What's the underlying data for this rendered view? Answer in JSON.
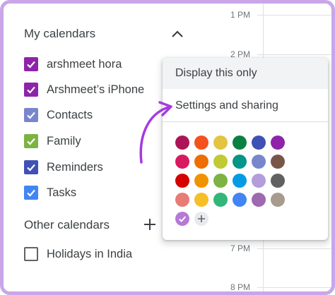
{
  "timeline": {
    "times": [
      "1 PM",
      "2 PM",
      "7 PM",
      "8 PM"
    ]
  },
  "sidebar": {
    "my_calendars_title": "My calendars",
    "other_calendars_title": "Other calendars",
    "my_calendars": [
      {
        "label": "arshmeet hora",
        "color": "#8e24aa",
        "checked": true
      },
      {
        "label": "Arshmeet’s iPhone",
        "color": "#8e24aa",
        "checked": true
      },
      {
        "label": "Contacts",
        "color": "#7986cb",
        "checked": true
      },
      {
        "label": "Family",
        "color": "#7cb342",
        "checked": true
      },
      {
        "label": "Reminders",
        "color": "#3f51b5",
        "checked": true
      },
      {
        "label": "Tasks",
        "color": "#4285f4",
        "checked": true
      }
    ],
    "other_calendars": [
      {
        "label": "Holidays in India",
        "color": "#5f6368",
        "checked": false
      }
    ]
  },
  "menu": {
    "items": [
      "Display this only",
      "Settings and sharing"
    ],
    "swatches": [
      [
        "#ad1457",
        "#f4511e",
        "#e4c441",
        "#0b8043",
        "#3f51b5",
        "#8e24aa"
      ],
      [
        "#d81b60",
        "#ef6c00",
        "#c0ca33",
        "#009688",
        "#7986cb",
        "#795548"
      ],
      [
        "#d50000",
        "#f09300",
        "#7cb342",
        "#039be5",
        "#b39ddb",
        "#616161"
      ],
      [
        "#e67c73",
        "#f6bf26",
        "#33b679",
        "#4285f4",
        "#9e69af",
        "#a79b8e"
      ]
    ],
    "selected_color": "#b679d8"
  },
  "accent": "#a43be0"
}
